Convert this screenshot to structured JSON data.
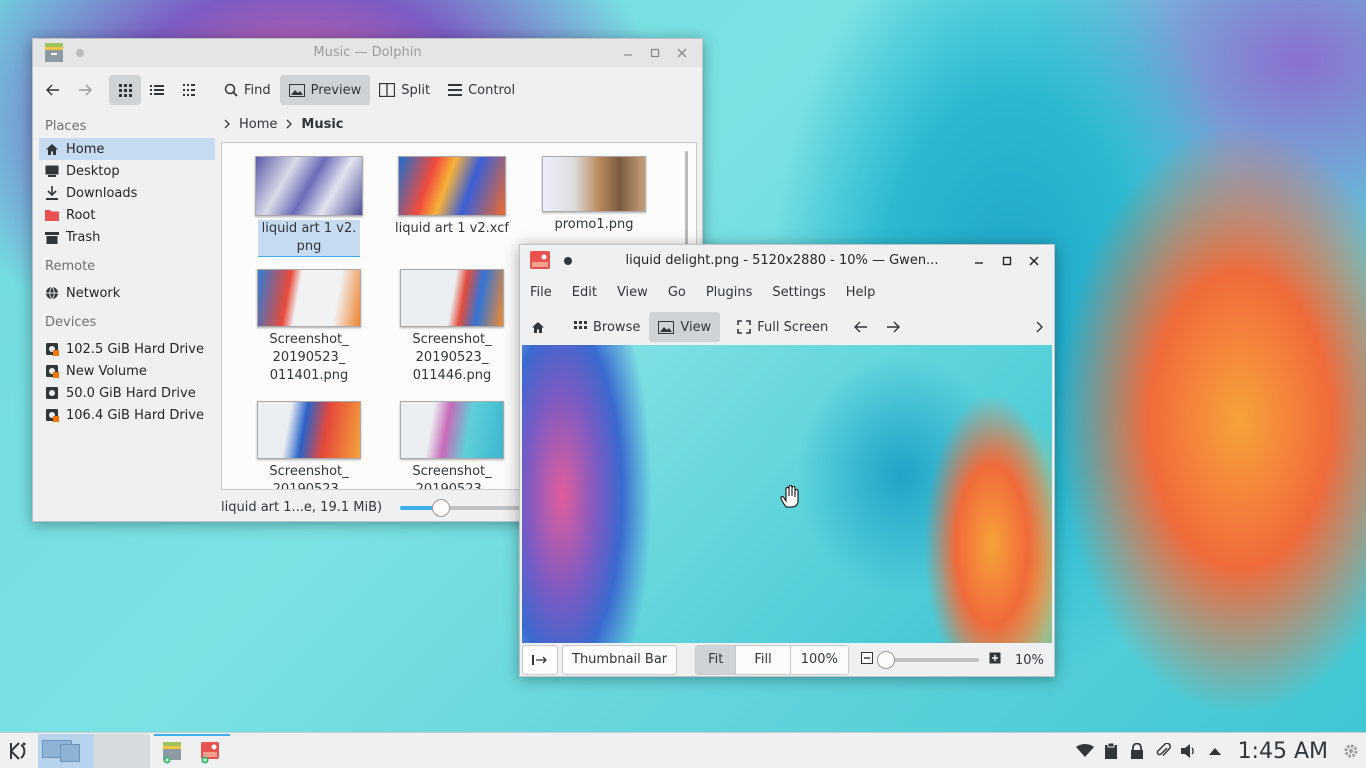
{
  "dolphin": {
    "title": "Music — Dolphin",
    "toolbar": {
      "find": "Find",
      "preview": "Preview",
      "split": "Split",
      "control": "Control"
    },
    "breadcrumb": {
      "root": "Home",
      "current": "Music"
    },
    "places": {
      "places_header": "Places",
      "items": [
        "Home",
        "Desktop",
        "Downloads",
        "Root",
        "Trash"
      ],
      "remote_header": "Remote",
      "remote_items": [
        "Network"
      ],
      "devices_header": "Devices",
      "devices": [
        "102.5 GiB Hard Drive",
        "New Volume",
        "50.0 GiB Hard Drive",
        "106.4 GiB Hard Drive"
      ]
    },
    "files": [
      {
        "name": "liquid art 1 v2.\npng"
      },
      {
        "name": "liquid art 1 v2.xcf"
      },
      {
        "name": "promo1.png"
      },
      {
        "name": "Screenshot_\n20190523_\n011401.png"
      },
      {
        "name": "Screenshot_\n20190523_\n011446.png"
      },
      {
        "name": "Screenshot_\n20190523_"
      },
      {
        "name": "Screenshot_\n20190523_"
      }
    ],
    "status": "liquid art 1...e, 19.1 MiB)",
    "zoom_slider_fraction": 0.2
  },
  "gwenview": {
    "title": "liquid delight.png - 5120x2880 - 10% — Gwen...",
    "menu": [
      "File",
      "Edit",
      "View",
      "Go",
      "Plugins",
      "Settings",
      "Help"
    ],
    "toolbar": {
      "browse": "Browse",
      "view": "View",
      "fullscreen": "Full Screen"
    },
    "bottombar": {
      "thumbnail_bar": "Thumbnail Bar",
      "fit": "Fit",
      "fill": "Fill",
      "hundred": "100%",
      "zoom_value": "10%"
    },
    "zoom_slider_fraction": 0.05
  },
  "taskbar": {
    "clock": "1:45 AM"
  },
  "colors": {
    "accent": "#3daee9",
    "selection": "#c7dbf0",
    "root_folder": "#e8524f"
  }
}
